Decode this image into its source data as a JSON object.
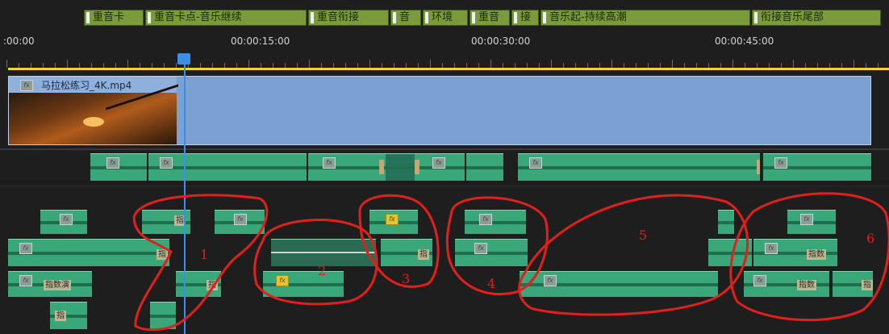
{
  "markers": [
    {
      "label": "重音卡",
      "left": 0,
      "width": 0
    },
    {
      "label": "重音卡点-音乐继续"
    },
    {
      "label": "重音衔接"
    },
    {
      "label": "音"
    },
    {
      "label": "环境"
    },
    {
      "label": "重音"
    },
    {
      "label": "接"
    },
    {
      "label": "音乐起-持续高潮"
    },
    {
      "label": "衔接音乐尾部"
    }
  ],
  "timecodes": [
    ":00:00",
    "00:00:15:00",
    "00:00:30:00",
    "00:00:45:00"
  ],
  "video_clip": {
    "name": "马拉松练习_4K.mp4",
    "fx": "fx"
  },
  "audio_tags": {
    "zhi": "指",
    "zhishu": "指数",
    "zhishu_long": "指数演",
    "zhishu_short": "指数"
  },
  "fx_label": "fx",
  "annotations": [
    "1",
    "2",
    "3",
    "4",
    "5",
    "6"
  ],
  "colors": {
    "marker_bg": "#7a9a3c",
    "video_bg": "#7aa0d4",
    "audio_clip": "#39a779",
    "playhead": "#3b8fe7",
    "annotation": "#e0201d",
    "work_area": "#f2d42a"
  }
}
